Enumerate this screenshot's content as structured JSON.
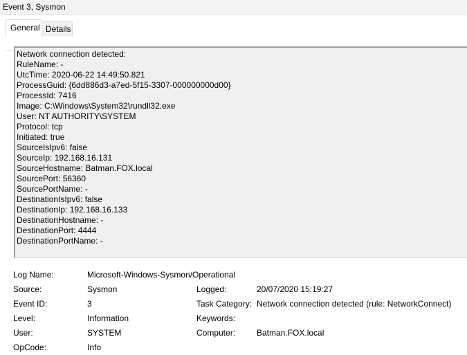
{
  "window": {
    "title": "Event 3, Sysmon"
  },
  "tabs": [
    {
      "label": "General",
      "selected": true
    },
    {
      "label": "Details",
      "selected": false
    }
  ],
  "description": {
    "lines": [
      "Network connection detected:",
      "RuleName: -",
      "UtcTime: 2020-06-22 14:49:50.821",
      "ProcessGuid: {6dd886d3-a7ed-5f15-3307-000000000d00}",
      "ProcessId: 7416",
      "Image: C:\\Windows\\System32\\rundll32.exe",
      "User: NT AUTHORITY\\SYSTEM",
      "Protocol: tcp",
      "Initiated: true",
      "SourceIsIpv6: false",
      "SourceIp: 192.168.16.131",
      "SourceHostname: Batman.FOX.local",
      "SourcePort: 56360",
      "SourcePortName: -",
      "DestinationIsIpv6: false",
      "DestinationIp: 192.168.16.133",
      "DestinationHostname: -",
      "DestinationPort: 4444",
      "DestinationPortName: -"
    ]
  },
  "details": {
    "log_name": {
      "label": "Log Name:",
      "value": "Microsoft-Windows-Sysmon/Operational"
    },
    "source": {
      "label": "Source:",
      "value": "Sysmon"
    },
    "logged": {
      "label": "Logged:",
      "value": "20/07/2020 15:19:27"
    },
    "event_id": {
      "label": "Event ID:",
      "value": "3"
    },
    "task_category": {
      "label": "Task Category:",
      "value": "Network connection detected (rule: NetworkConnect)"
    },
    "level": {
      "label": "Level:",
      "value": "Information"
    },
    "keywords": {
      "label": "Keywords:",
      "value": ""
    },
    "user": {
      "label": "User:",
      "value": "SYSTEM"
    },
    "computer": {
      "label": "Computer:",
      "value": "Batman.FOX.local"
    },
    "opcode": {
      "label": "OpCode:",
      "value": "Info"
    }
  }
}
